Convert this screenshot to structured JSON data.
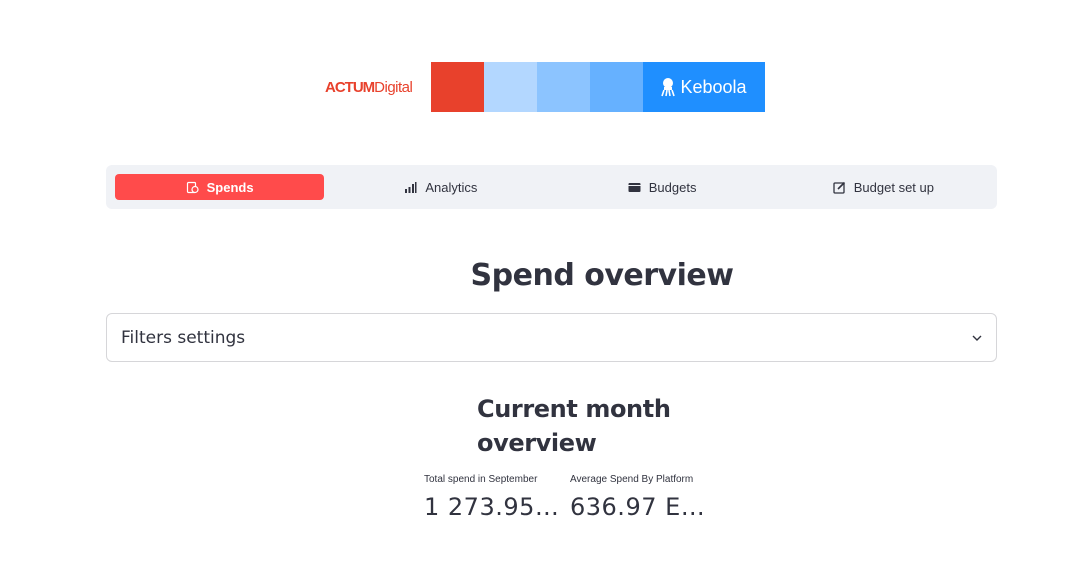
{
  "logo": {
    "actum_bold": "ACTUM",
    "actum_light": "Digital",
    "keboola": "Keboola",
    "colors": [
      "#e8412c",
      "#b3d7ff",
      "#8cc4ff",
      "#66b1ff"
    ],
    "keboola_color": "#1f8fff",
    "actum_color": "#e8412c"
  },
  "nav": {
    "items": [
      {
        "label": "Spends",
        "icon": "receipt-icon",
        "active": true
      },
      {
        "label": "Analytics",
        "icon": "bar-chart-icon",
        "active": false
      },
      {
        "label": "Budgets",
        "icon": "wallet-icon",
        "active": false
      },
      {
        "label": "Budget set up",
        "icon": "edit-icon",
        "active": false
      }
    ],
    "active_color": "#ff4b4b"
  },
  "title": "Spend overview",
  "filters": {
    "label": "Filters settings"
  },
  "current_month": {
    "heading": "Current month overview",
    "metrics": [
      {
        "label": "Total spend in September",
        "value": "1 273.95 …"
      },
      {
        "label": "Average Spend By Platform",
        "value": "636.97 E…"
      }
    ]
  }
}
